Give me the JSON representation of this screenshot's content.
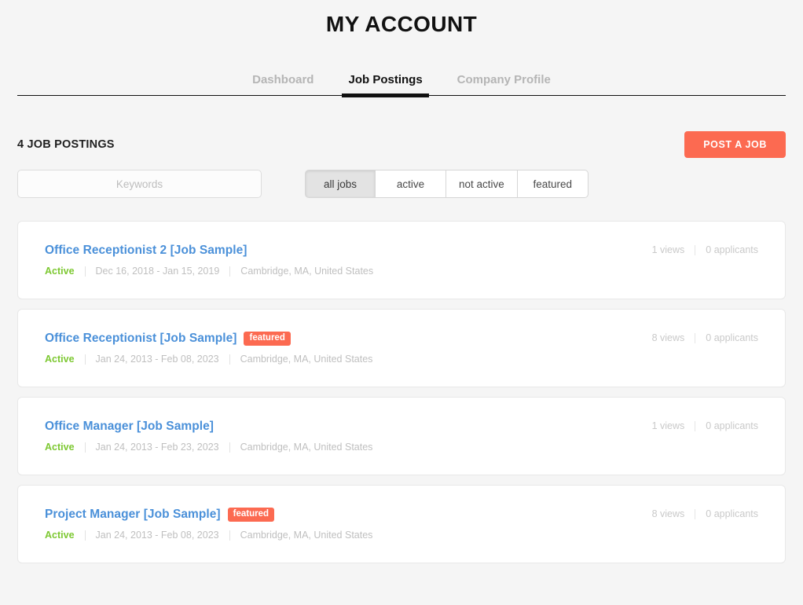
{
  "header": {
    "title": "MY ACCOUNT",
    "tabs": [
      {
        "label": "Dashboard",
        "active": false
      },
      {
        "label": "Job Postings",
        "active": true
      },
      {
        "label": "Company Profile",
        "active": false
      }
    ]
  },
  "toolbar": {
    "count_heading": "4 JOB POSTINGS",
    "post_job_label": "POST A JOB"
  },
  "filters": {
    "keywords_placeholder": "Keywords",
    "keywords_value": "",
    "segments": [
      {
        "label": "all jobs",
        "selected": true
      },
      {
        "label": "active",
        "selected": false
      },
      {
        "label": "not active",
        "selected": false
      },
      {
        "label": "featured",
        "selected": false
      }
    ]
  },
  "jobs": [
    {
      "title": "Office Receptionist 2 [Job Sample]",
      "featured": false,
      "featured_label": "featured",
      "status": "Active",
      "dates": "Dec 16, 2018 - Jan 15, 2019",
      "location": "Cambridge, MA, United States",
      "views": "1 views",
      "applicants": "0 applicants"
    },
    {
      "title": "Office Receptionist [Job Sample]",
      "featured": true,
      "featured_label": "featured",
      "status": "Active",
      "dates": "Jan 24, 2013 - Feb 08, 2023",
      "location": "Cambridge, MA, United States",
      "views": "8 views",
      "applicants": "0 applicants"
    },
    {
      "title": "Office Manager [Job Sample]",
      "featured": false,
      "featured_label": "featured",
      "status": "Active",
      "dates": "Jan 24, 2013 - Feb 23, 2023",
      "location": "Cambridge, MA, United States",
      "views": "1 views",
      "applicants": "0 applicants"
    },
    {
      "title": "Project Manager [Job Sample]",
      "featured": true,
      "featured_label": "featured",
      "status": "Active",
      "dates": "Jan 24, 2013 - Feb 08, 2023",
      "location": "Cambridge, MA, United States",
      "views": "8 views",
      "applicants": "0 applicants"
    }
  ],
  "colors": {
    "accent": "#fc6a51",
    "link": "#4a90d9",
    "status_active": "#7dc832",
    "page_bg": "#f5f5f5",
    "muted": "#bfbfbf"
  }
}
